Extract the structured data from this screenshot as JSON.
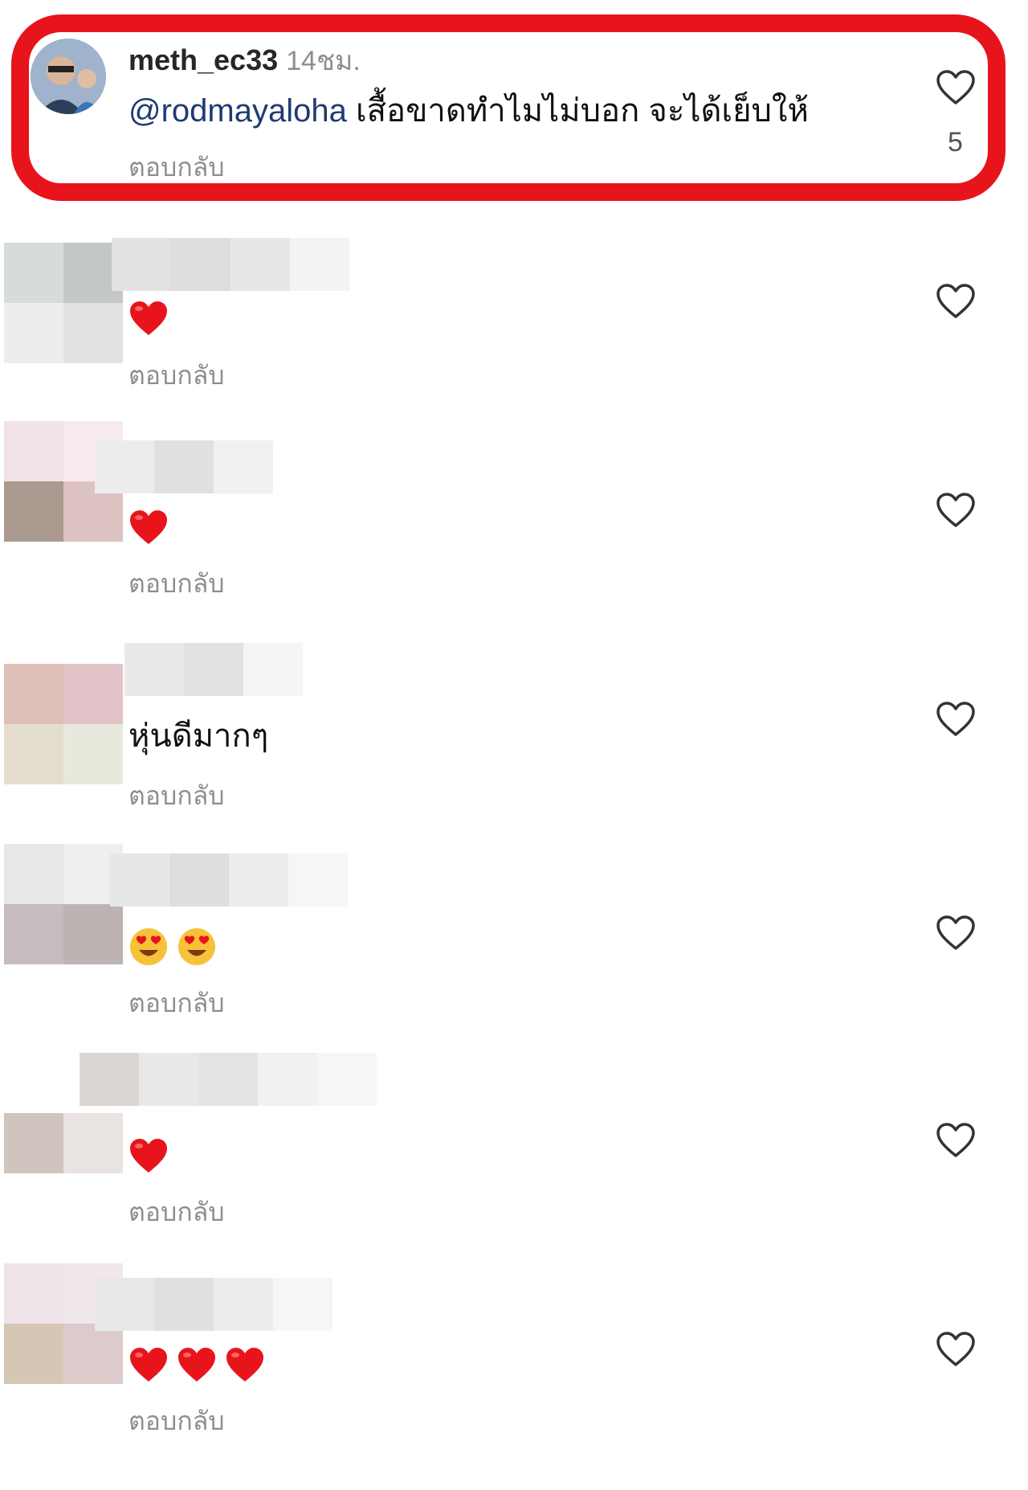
{
  "highlighted_comment": {
    "username": "meth_ec33",
    "time": "14ชม.",
    "mention": "@rodmayaloha",
    "text": " เสื้อขาดทำไมไม่บอก จะได้เย็บให้",
    "reply_label": "ตอบกลับ",
    "like_count": "5",
    "like_icon": "heart-outline-icon",
    "avatar": "profile-photo",
    "highlight_color": "#e8141c"
  },
  "comments": [
    {
      "emoji": [
        "heart"
      ],
      "reply_label": "ตอบกลับ",
      "avatar_colors": [
        "#d6dcd9",
        "#c3c8c4",
        "#eceded",
        "#e1e3e2"
      ],
      "name_colors": [
        "#e2e2e2",
        "#dedede",
        "#e7e7e7",
        "#f3f3f3"
      ]
    },
    {
      "emoji": [
        "heart"
      ],
      "reply_label": "ตอบกลับ",
      "avatar_colors": [
        "#f1e3e6",
        "#f6eaee",
        "#ab9a8f",
        "#dcc3c1"
      ],
      "name_colors": [
        "#ececec",
        "#e0e0e0",
        "#f1f1f1"
      ]
    },
    {
      "text": "หุ่นดีมากๆ",
      "reply_label": "ตอบกลับ",
      "avatar_colors": [
        "#dfc0b9",
        "#e2c3c8",
        "#e5ddd0",
        "#e9e8dc"
      ],
      "name_colors": [
        "#e9e9e9",
        "#e2e2e2",
        "#f5f5f5"
      ]
    },
    {
      "emoji": [
        "heart-eyes",
        "heart-eyes"
      ],
      "reply_label": "ตอบกลับ",
      "avatar_colors": [
        "#e7e8e8",
        "#eeeeee",
        "#c6bcbf",
        "#bdb3b3"
      ],
      "name_colors": [
        "#e7e7e7",
        "#dedede",
        "#ececec",
        "#f6f6f6"
      ]
    },
    {
      "emoji": [
        "heart"
      ],
      "reply_label": "ตอบกลับ",
      "avatar_colors": [
        "#ffffff",
        "#ffffff",
        "#cfc4be",
        "#e9e3e1"
      ],
      "name_colors": [
        "#dcd6d2",
        "#e9e9e9",
        "#e3e3e3",
        "#f1f1f1",
        "#f6f6f6"
      ]
    },
    {
      "emoji": [
        "heart",
        "heart",
        "heart"
      ],
      "reply_label": "ตอบกลับ",
      "avatar_colors": [
        "#efe5e8",
        "#f0e8ea",
        "#d5c7b4",
        "#ddcbcb"
      ],
      "name_colors": [
        "#e8e8e8",
        "#e0e0e0",
        "#ececec",
        "#f6f6f6"
      ]
    }
  ]
}
